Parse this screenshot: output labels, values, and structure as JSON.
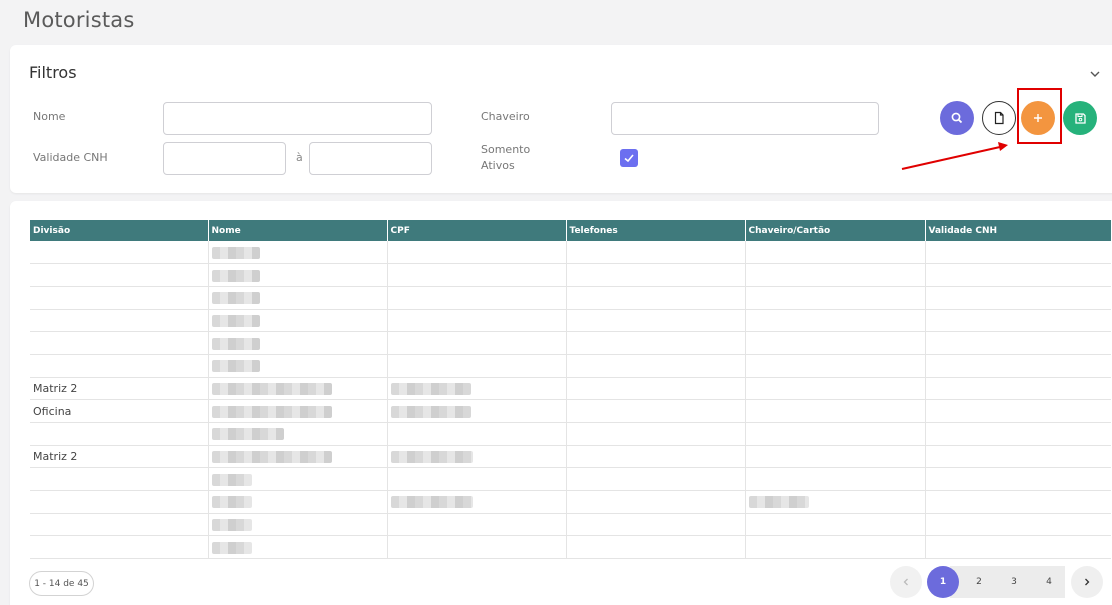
{
  "page": {
    "title": "Motoristas"
  },
  "filters": {
    "title": "Filtros",
    "nome_label": "Nome",
    "nome_value": "",
    "validade_label": "Validade CNH",
    "validade_from": "",
    "validade_sep": "à",
    "validade_to": "",
    "chaveiro_label": "Chaveiro",
    "chaveiro_value": "",
    "somente_ativos_label_1": "Somento",
    "somente_ativos_label_2": "Ativos",
    "somente_ativos_checked": true,
    "actions": [
      "search-icon",
      "pdf-icon",
      "plus-icon",
      "save-icon"
    ],
    "colors": {
      "search": "#6c6bdc",
      "add": "#f3953f",
      "save": "#26b27b",
      "highlight": "#e00000"
    }
  },
  "table": {
    "columns": [
      "Divisão",
      "Nome",
      "CPF",
      "Telefones",
      "Chaveiro/Cartão",
      "Validade CNH"
    ],
    "header_color": "#3f7a7c",
    "rows": [
      {
        "divisao": ""
      },
      {
        "divisao": ""
      },
      {
        "divisao": ""
      },
      {
        "divisao": ""
      },
      {
        "divisao": ""
      },
      {
        "divisao": ""
      },
      {
        "divisao": "Matriz 2"
      },
      {
        "divisao": "Oficina"
      },
      {
        "divisao": ""
      },
      {
        "divisao": "Matriz 2"
      },
      {
        "divisao": ""
      },
      {
        "divisao": ""
      },
      {
        "divisao": ""
      },
      {
        "divisao": ""
      }
    ]
  },
  "pagination": {
    "count": "1 - 14 de 45",
    "pages": [
      "1",
      "2",
      "3",
      "4"
    ],
    "current": "1"
  }
}
